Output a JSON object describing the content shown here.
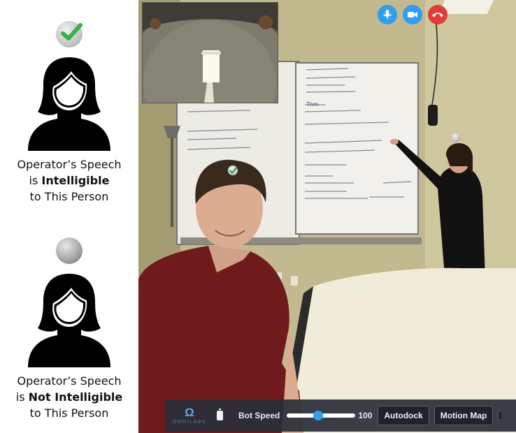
{
  "legend": {
    "intelligible": {
      "line1": "Operator’s Speech",
      "line2_prefix": "is ",
      "line2_emphasis": "Intelligible",
      "line3": "to This Person",
      "icon": "checkmark-icon"
    },
    "not_intelligible": {
      "line1": "Operator’s Speech",
      "line2_prefix": "is ",
      "line2_emphasis": "Not Intelligible",
      "line3": "to This Person",
      "icon": "grey-dot-icon"
    }
  },
  "call_controls": {
    "mic": "microphone-icon",
    "camera": "camera-icon",
    "hangup": "hangup-icon",
    "accent": "#2e9ff0",
    "hangup_color": "#e23b3b"
  },
  "toolbar": {
    "brand": "OMNILABS",
    "brand_logo": "Ω",
    "speed_label": "Bot Speed",
    "speed_value": "100",
    "speed_fraction": 0.45,
    "autodock_label": "Autodock",
    "motion_map_label": "Motion Map"
  },
  "whiteboard": {
    "heading": "Thm"
  }
}
